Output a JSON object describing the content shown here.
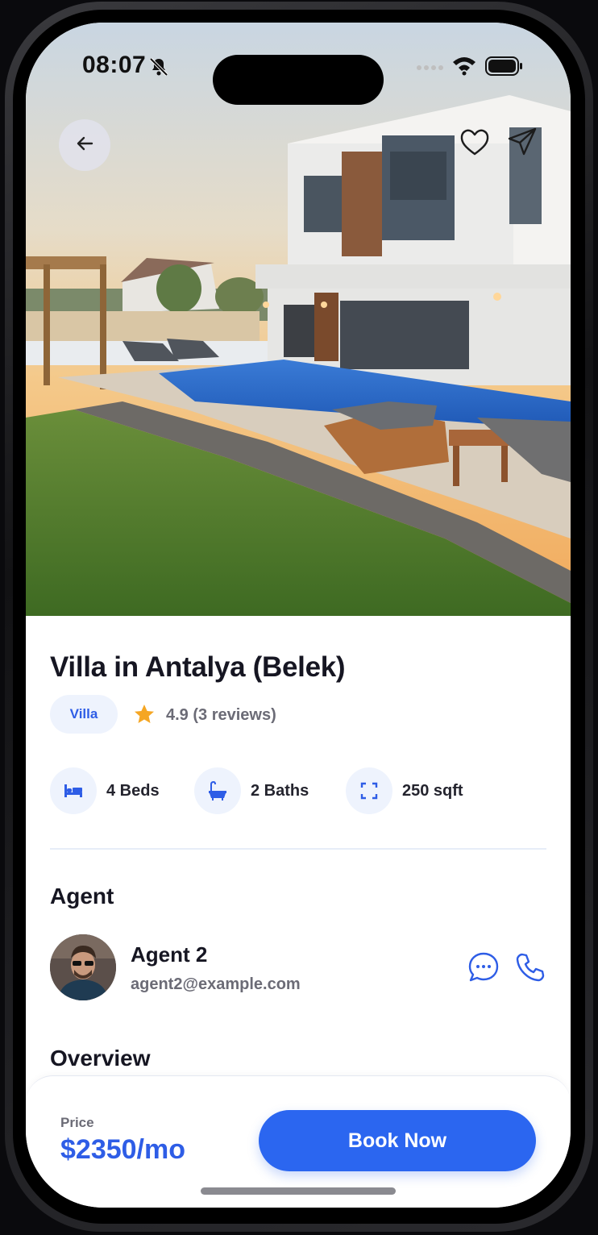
{
  "status_bar": {
    "time": "08:07",
    "icons": [
      "bell-slash-icon",
      "cellular-signal-icon",
      "wifi-icon",
      "battery-icon"
    ]
  },
  "hero": {
    "image_alt": "Modern white villa with swimming pool, sun loungers and lawn at sunset",
    "icons": [
      "arrow-left-icon",
      "heart-icon",
      "send-icon"
    ]
  },
  "listing": {
    "title": "Villa in Antalya (Belek)",
    "type_badge": "Villa",
    "rating_text": "4.9 (3 reviews)",
    "features": [
      {
        "icon": "bed-icon",
        "label": "4 Beds"
      },
      {
        "icon": "bathtub-icon",
        "label": "2 Baths"
      },
      {
        "icon": "expand-icon",
        "label": "250 sqft"
      }
    ]
  },
  "agent_section": {
    "heading": "Agent",
    "name": "Agent 2",
    "email": "agent2@example.com",
    "icons": [
      "chat-icon",
      "phone-icon"
    ]
  },
  "overview_section": {
    "heading": "Overview"
  },
  "footer": {
    "price_label": "Price",
    "price_value": "$2350/mo",
    "book_label": "Book Now"
  },
  "colors": {
    "accent": "#2b66f0",
    "price_text": "#2e5de6",
    "badge_bg": "#eef3fd",
    "star": "#f5a623",
    "title_text": "#161622",
    "muted_text": "#6b6b76"
  }
}
